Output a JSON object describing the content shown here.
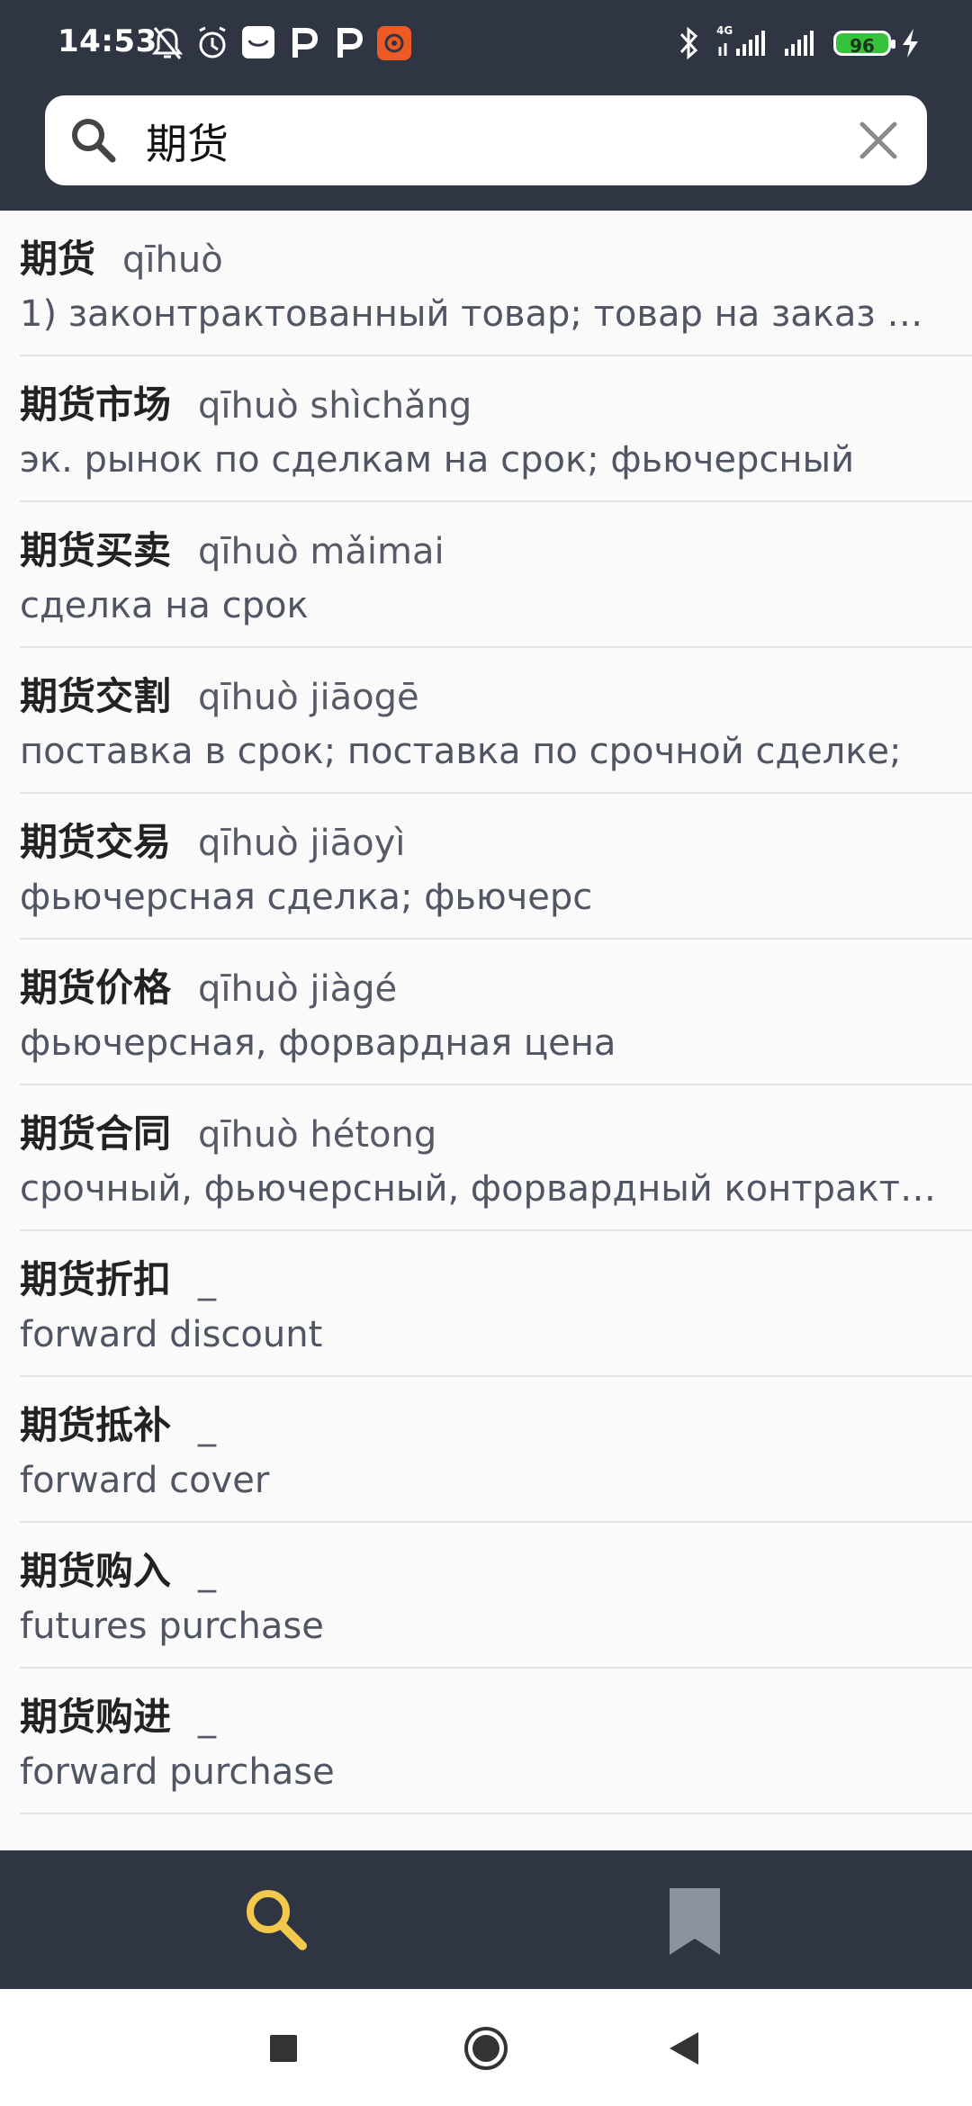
{
  "status_bar": {
    "time": "14:53",
    "battery": "96",
    "network": "4G",
    "icons": [
      "bell-off-icon",
      "alarm-icon",
      "app-icon",
      "p-icon",
      "p-icon",
      "recorder-icon",
      "bluetooth-icon",
      "signal-icon",
      "signal-icon",
      "charging-icon"
    ]
  },
  "search": {
    "value": "期货",
    "icon": "search-icon",
    "clear_icon": "close-icon"
  },
  "results": [
    {
      "headword": "期货",
      "pinyin": "qīhuò",
      "definition": "1) законтрактованный товар; товар на заказ 2) ..."
    },
    {
      "headword": "期货市场",
      "pinyin": "qīhuò shìchǎng",
      "definition": "эк. рынок по сделкам на срок; фьючерсный"
    },
    {
      "headword": "期货买卖",
      "pinyin": "qīhuò mǎimai",
      "definition": "сделка на срок"
    },
    {
      "headword": "期货交割",
      "pinyin": "qīhuò jiāogē",
      "definition": "поставка в срок; поставка по срочной сделке;"
    },
    {
      "headword": "期货交易",
      "pinyin": "qīhuò jiāoyì",
      "definition": "фьючерсная сделка; фьючерс"
    },
    {
      "headword": "期货价格",
      "pinyin": "qīhuò jiàgé",
      "definition": "фьючерсная, форвардная цена"
    },
    {
      "headword": "期货合同",
      "pinyin": "qīhuò hétong",
      "definition": "срочный, фьючерсный, форвардный контракт (..."
    },
    {
      "headword": "期货折扣",
      "pinyin": "_",
      "definition": "forward discount"
    },
    {
      "headword": "期货抵补",
      "pinyin": "_",
      "definition": "forward cover"
    },
    {
      "headword": "期货购入",
      "pinyin": "_",
      "definition": "futures purchase"
    },
    {
      "headword": "期货购进",
      "pinyin": "_",
      "definition": "forward purchase"
    }
  ],
  "bottom_nav": {
    "items": [
      {
        "name": "search",
        "icon": "search-icon",
        "active": true,
        "color": "#f2c94c"
      },
      {
        "name": "bookmarks",
        "icon": "bookmark-icon",
        "active": false,
        "color": "#8d939d"
      }
    ]
  },
  "colors": {
    "header_bg": "#2f3542",
    "accent": "#f2c94c",
    "battery": "#36c23b"
  }
}
